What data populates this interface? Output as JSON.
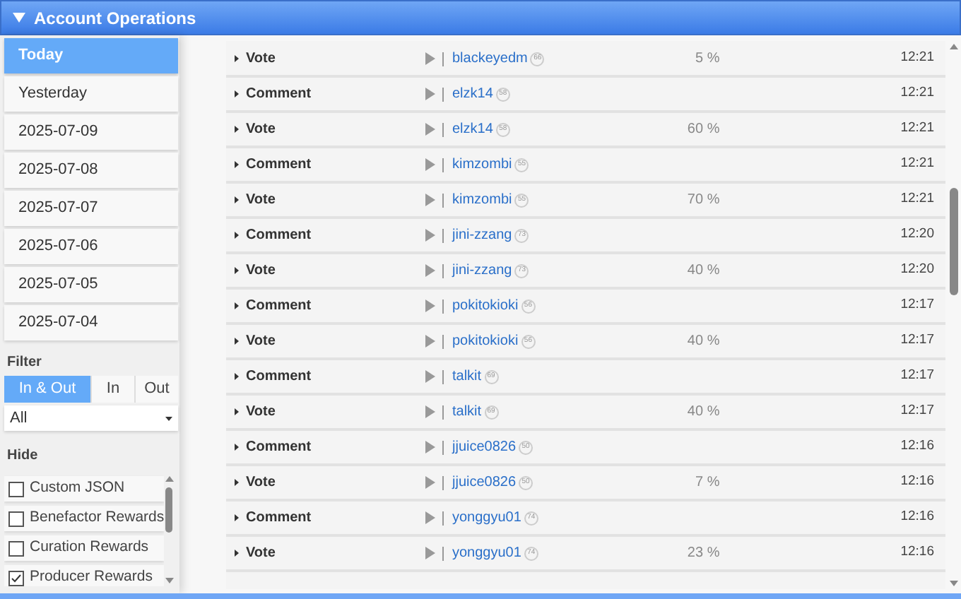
{
  "panel": {
    "title": "Account Operations",
    "expanded": true
  },
  "dates": [
    {
      "label": "Today",
      "selected": true
    },
    {
      "label": "Yesterday",
      "selected": false
    },
    {
      "label": "2025-07-09",
      "selected": false
    },
    {
      "label": "2025-07-08",
      "selected": false
    },
    {
      "label": "2025-07-07",
      "selected": false
    },
    {
      "label": "2025-07-06",
      "selected": false
    },
    {
      "label": "2025-07-05",
      "selected": false
    },
    {
      "label": "2025-07-04",
      "selected": false
    }
  ],
  "filter": {
    "label": "Filter",
    "options": [
      {
        "label": "In & Out",
        "selected": true
      },
      {
        "label": "In",
        "selected": false
      },
      {
        "label": "Out",
        "selected": false
      }
    ],
    "select_value": "All"
  },
  "hide": {
    "label": "Hide",
    "items": [
      {
        "label": "Custom JSON",
        "checked": false
      },
      {
        "label": "Benefactor Rewards",
        "checked": false
      },
      {
        "label": "Curation Rewards",
        "checked": false
      },
      {
        "label": "Producer Rewards",
        "checked": true
      }
    ]
  },
  "operations": [
    {
      "type": "Vote",
      "user": "blackeyedm",
      "reputation": "66",
      "weight": "5 %",
      "time": "12:21"
    },
    {
      "type": "Comment",
      "user": "elzk14",
      "reputation": "58",
      "time": "12:21"
    },
    {
      "type": "Vote",
      "user": "elzk14",
      "reputation": "58",
      "weight": "60 %",
      "time": "12:21"
    },
    {
      "type": "Comment",
      "user": "kimzombi",
      "reputation": "55",
      "time": "12:21"
    },
    {
      "type": "Vote",
      "user": "kimzombi",
      "reputation": "55",
      "weight": "70 %",
      "time": "12:21"
    },
    {
      "type": "Comment",
      "user": "jini-zzang",
      "reputation": "73",
      "time": "12:20"
    },
    {
      "type": "Vote",
      "user": "jini-zzang",
      "reputation": "73",
      "weight": "40 %",
      "time": "12:20"
    },
    {
      "type": "Comment",
      "user": "pokitokioki",
      "reputation": "56",
      "time": "12:17"
    },
    {
      "type": "Vote",
      "user": "pokitokioki",
      "reputation": "56",
      "weight": "40 %",
      "time": "12:17"
    },
    {
      "type": "Comment",
      "user": "talkit",
      "reputation": "69",
      "time": "12:17"
    },
    {
      "type": "Vote",
      "user": "talkit",
      "reputation": "69",
      "weight": "40 %",
      "time": "12:17"
    },
    {
      "type": "Comment",
      "user": "jjuice0826",
      "reputation": "50",
      "time": "12:16"
    },
    {
      "type": "Vote",
      "user": "jjuice0826",
      "reputation": "50",
      "weight": "7 %",
      "time": "12:16"
    },
    {
      "type": "Comment",
      "user": "yonggyu01",
      "reputation": "74",
      "time": "12:16"
    },
    {
      "type": "Vote",
      "user": "yonggyu01",
      "reputation": "74",
      "weight": "23 %",
      "time": "12:16"
    }
  ]
}
